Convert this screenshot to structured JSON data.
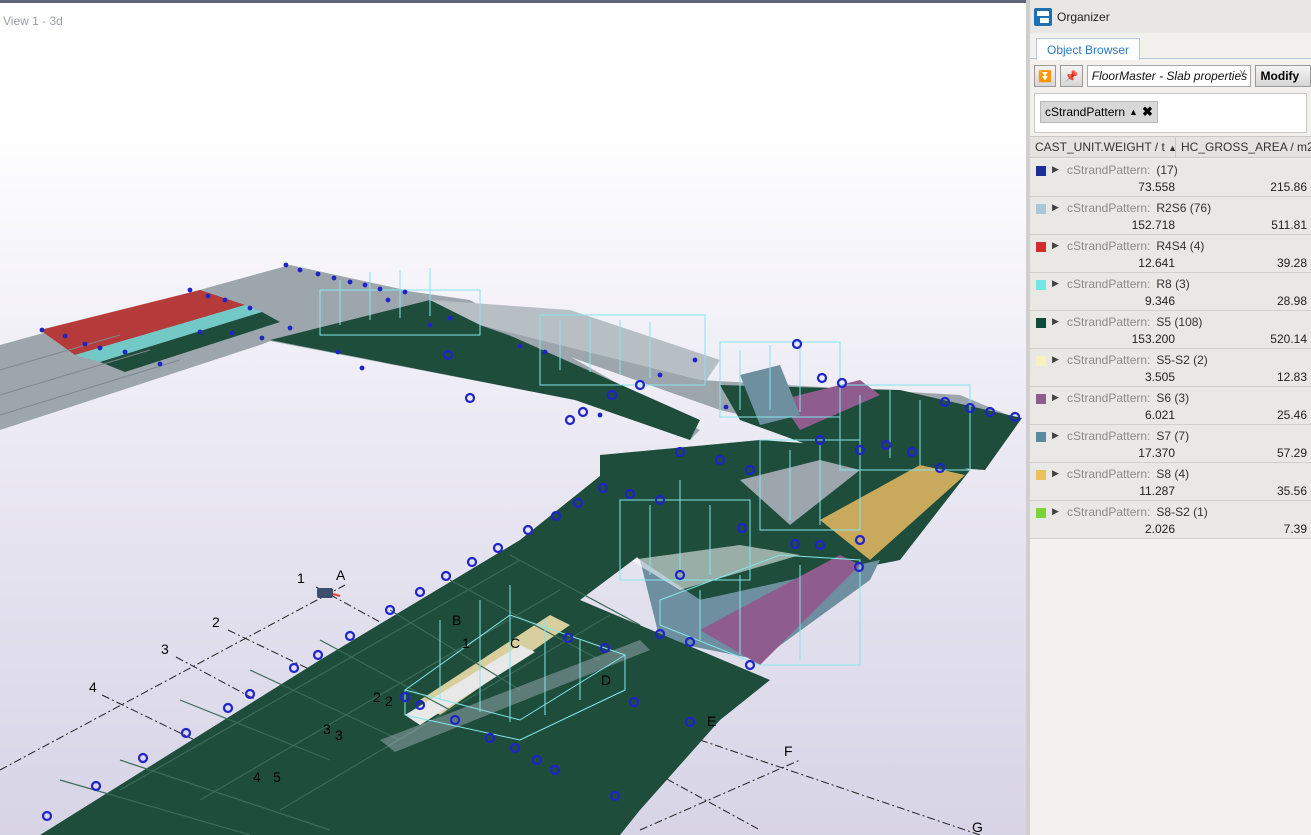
{
  "viewport": {
    "title": "View 1 - 3d",
    "grid_labels": {
      "n1": "1",
      "n2": "2",
      "n3": "3",
      "n4": "4",
      "nA": "A",
      "nB": "B",
      "nC": "C",
      "nD": "D",
      "nE": "E",
      "nF": "F",
      "nG": "G",
      "p11": "1",
      "p22a": "2",
      "p22b": "2",
      "p33a": "3",
      "p33b": "3",
      "p4": "4",
      "p5": "5"
    },
    "colors": {
      "dark_slab": "#1e4d3c",
      "grey_slab": "#9da6ad",
      "red_slab": "#b53b3b",
      "cyan_slab": "#73c9c6",
      "purple_slab": "#8f5c8e",
      "yellow_slab": "#c9aa5d",
      "blue_slab": "#6d8fa0",
      "marker": "#1f24c9",
      "load_frame": "#84e6ec"
    }
  },
  "organizer": {
    "title": "Organizer",
    "logo_icon": "organizer-logo-icon",
    "tab": "Object Browser",
    "toolbar": {
      "collapse_icon": "collapse-icon",
      "pin_icon": "pin-icon",
      "property_set": "FloorMaster - Slab properties",
      "modify_label": "Modify"
    },
    "group_chip": "cStrandPattern",
    "columns": {
      "weight": "CAST_UNIT.WEIGHT / t",
      "area": "HC_GROSS_AREA / m2"
    },
    "groups": [
      {
        "label": "cStrandPattern:",
        "value": "(17)",
        "color": "#1b2f9a",
        "weight": "73.558",
        "area": "215.86"
      },
      {
        "label": "cStrandPattern:",
        "value": "R2S6 (76)",
        "color": "#a8c8d8",
        "weight": "152.718",
        "area": "511.81"
      },
      {
        "label": "cStrandPattern:",
        "value": "R4S4 (4)",
        "color": "#d32a2a",
        "weight": "12.641",
        "area": "39.28"
      },
      {
        "label": "cStrandPattern:",
        "value": "R8 (3)",
        "color": "#6ee8e4",
        "weight": "9.346",
        "area": "28.98"
      },
      {
        "label": "cStrandPattern:",
        "value": "S5 (108)",
        "color": "#0f4a3a",
        "weight": "153.200",
        "area": "520.14"
      },
      {
        "label": "cStrandPattern:",
        "value": "S5-S2 (2)",
        "color": "#f5f2c0",
        "weight": "3.505",
        "area": "12.83"
      },
      {
        "label": "cStrandPattern:",
        "value": "S6 (3)",
        "color": "#8f5c8e",
        "weight": "6.021",
        "area": "25.46"
      },
      {
        "label": "cStrandPattern:",
        "value": "S7 (7)",
        "color": "#5e8aa0",
        "weight": "17.370",
        "area": "57.29"
      },
      {
        "label": "cStrandPattern:",
        "value": "S8 (4)",
        "color": "#e6c35a",
        "weight": "11.287",
        "area": "35.56"
      },
      {
        "label": "cStrandPattern:",
        "value": "S8-S2 (1)",
        "color": "#7ed23a",
        "weight": "2.026",
        "area": "7.39"
      }
    ]
  }
}
